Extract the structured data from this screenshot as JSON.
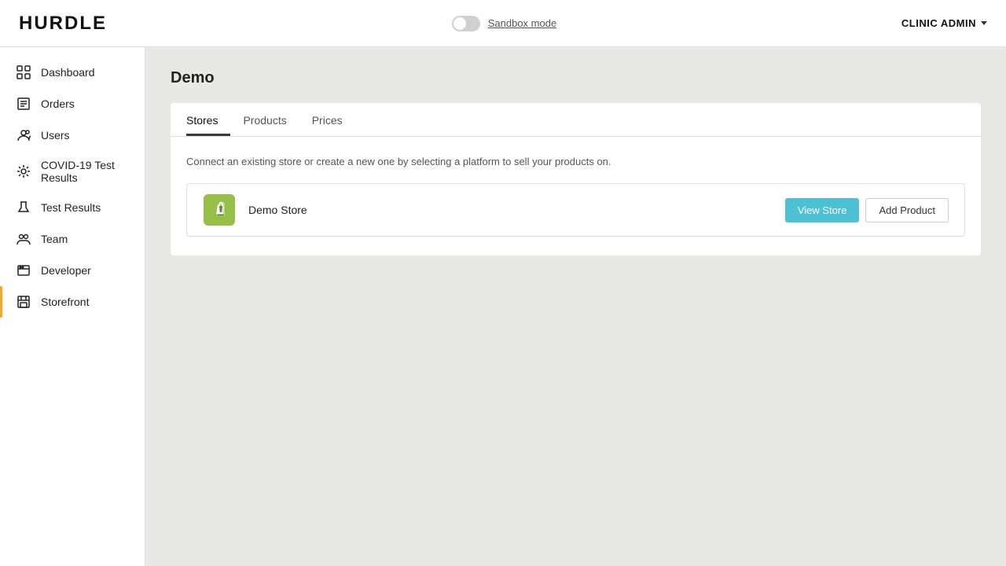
{
  "header": {
    "logo": "HURDLE",
    "sandbox_label": "Sandbox mode",
    "admin_label": "CLINIC ADMIN"
  },
  "sidebar": {
    "items": [
      {
        "id": "dashboard",
        "label": "Dashboard",
        "icon": "dashboard-icon",
        "active": false
      },
      {
        "id": "orders",
        "label": "Orders",
        "icon": "orders-icon",
        "active": false
      },
      {
        "id": "users",
        "label": "Users",
        "icon": "users-icon",
        "active": false
      },
      {
        "id": "covid-test-results",
        "label": "COVID-19 Test Results",
        "icon": "covid-icon",
        "active": false
      },
      {
        "id": "test-results",
        "label": "Test Results",
        "icon": "test-results-icon",
        "active": false
      },
      {
        "id": "team",
        "label": "Team",
        "icon": "team-icon",
        "active": false
      },
      {
        "id": "developer",
        "label": "Developer",
        "icon": "developer-icon",
        "active": false
      },
      {
        "id": "storefront",
        "label": "Storefront",
        "icon": "storefront-icon",
        "active": true
      }
    ]
  },
  "main": {
    "page_title": "Demo",
    "tabs": [
      {
        "id": "stores",
        "label": "Stores",
        "active": true
      },
      {
        "id": "products",
        "label": "Products",
        "active": false
      },
      {
        "id": "prices",
        "label": "Prices",
        "active": false
      }
    ],
    "tab_description": "Connect an existing store or create a new one by selecting a platform to sell your products on.",
    "stores": [
      {
        "name": "Demo Store",
        "view_label": "View Store",
        "add_label": "Add Product"
      }
    ]
  }
}
